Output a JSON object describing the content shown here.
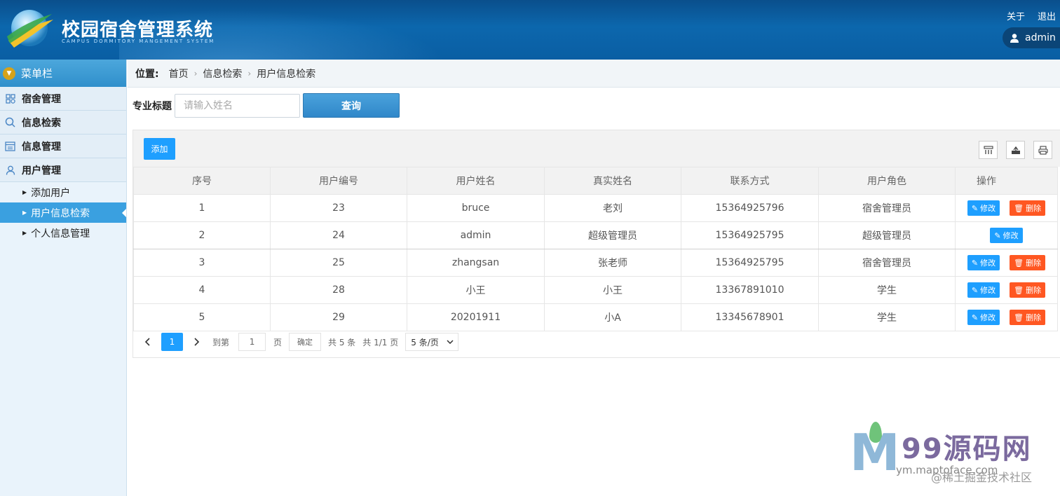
{
  "header": {
    "title": "校园宿舍管理系统",
    "subtitle": "CAMPUS DORMITORY MANGEMENT SYSTEM",
    "about": "关于",
    "logout": "退出",
    "username": "admin"
  },
  "sidebar": {
    "heading": "菜单栏",
    "groups": [
      {
        "label": "宿舍管理",
        "icon": "dorm-icon"
      },
      {
        "label": "信息检索",
        "icon": "search-icon"
      },
      {
        "label": "信息管理",
        "icon": "list-icon"
      },
      {
        "label": "用户管理",
        "icon": "user-icon"
      }
    ],
    "subitems": [
      {
        "label": "添加用户",
        "active": false
      },
      {
        "label": "用户信息检索",
        "active": true
      },
      {
        "label": "个人信息管理",
        "active": false
      }
    ]
  },
  "breadcrumb": {
    "label": "位置:",
    "items": [
      "首页",
      "信息检索",
      "用户信息检索"
    ]
  },
  "search": {
    "label": "专业标题",
    "placeholder": "请输入姓名",
    "button": "查询"
  },
  "toolbar": {
    "add": "添加"
  },
  "table": {
    "columns": [
      "序号",
      "用户编号",
      "用户姓名",
      "真实姓名",
      "联系方式",
      "用户角色",
      "操作"
    ],
    "edit_label": "修改",
    "delete_label": "删除",
    "rows": [
      {
        "seq": "1",
        "id": "23",
        "username": "bruce",
        "realname": "老刘",
        "phone": "15364925796",
        "role": "宿舍管理员",
        "deletable": true
      },
      {
        "seq": "2",
        "id": "24",
        "username": "admin",
        "realname": "超级管理员",
        "phone": "15364925795",
        "role": "超级管理员",
        "deletable": false
      },
      {
        "seq": "3",
        "id": "25",
        "username": "zhangsan",
        "realname": "张老师",
        "phone": "15364925795",
        "role": "宿舍管理员",
        "deletable": true
      },
      {
        "seq": "4",
        "id": "28",
        "username": "小王",
        "realname": "小王",
        "phone": "13367891010",
        "role": "学生",
        "deletable": true
      },
      {
        "seq": "5",
        "id": "29",
        "username": "20201911",
        "realname": "小A",
        "phone": "13345678901",
        "role": "学生",
        "deletable": true
      }
    ]
  },
  "pager": {
    "current": "1",
    "goto_label": "到第",
    "goto_value": "1",
    "page_label": "页",
    "confirm": "确定",
    "total": "共 5 条",
    "pages": "共 1/1 页",
    "per_page": "5 条/页"
  },
  "watermark": {
    "brand": "99源码网",
    "url": "ym.maptoface.com",
    "community": "@稀土掘金技术社区"
  },
  "colors": {
    "header": "#0c67ad",
    "primary": "#1e9fff",
    "danger": "#ff5722",
    "active_menu": "#3aa0e0"
  }
}
